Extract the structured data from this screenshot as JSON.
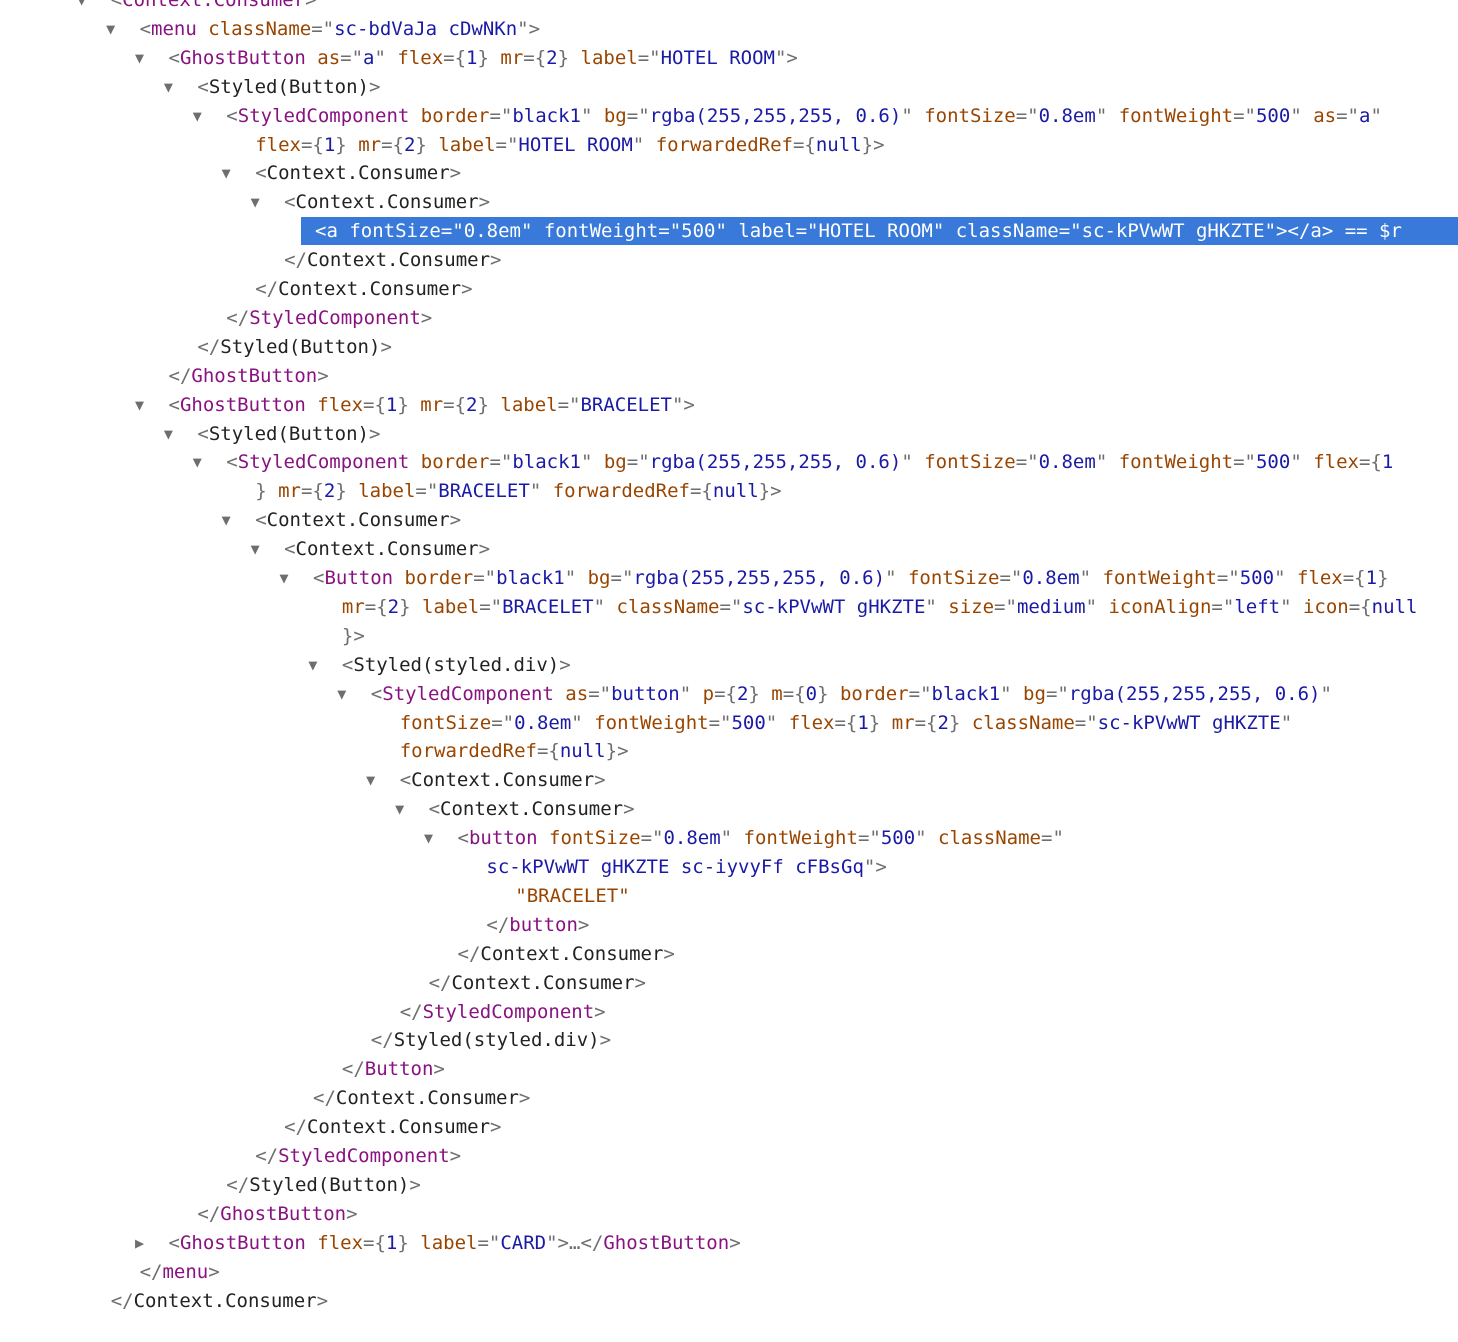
{
  "tree": [
    [
      3,
      "down",
      "<",
      "Context.Consumer",
      ">"
    ],
    [
      4,
      "down",
      "<",
      "menu",
      " ",
      "className",
      "=\"",
      "sc-bdVaJa cDwNKn",
      "\">"
    ],
    [
      5,
      "down",
      "<",
      "GhostButton",
      " ",
      "as",
      "=\"",
      "a",
      "\" ",
      "flex",
      "={",
      "1",
      "} ",
      "mr",
      "={",
      "2",
      "} ",
      "label",
      "=\"",
      "HOTEL ROOM",
      "\">"
    ],
    [
      6,
      "down",
      "<",
      "Styled(Button)",
      ">"
    ],
    [
      7,
      "down",
      "<",
      "StyledComponent",
      " ",
      "border",
      "=\"",
      "black1",
      "\" ",
      "bg",
      "=\"",
      "rgba(255,255,255, 0.6)",
      "\" ",
      "fontSize",
      "=\"",
      "0.8em",
      "\" ",
      "fontWeight",
      "=\"",
      "500",
      "\" ",
      "as",
      "=\"",
      "a",
      "\""
    ],
    [
      8,
      "",
      "flex",
      "={",
      "1",
      "} ",
      "mr",
      "={",
      "2",
      "} ",
      "label",
      "=\"",
      "HOTEL ROOM",
      "\" ",
      "forwardedRef",
      "={",
      "null",
      "}>"
    ],
    [
      8,
      "down",
      "<",
      "Context.Consumer",
      ">"
    ],
    [
      9,
      "down",
      "<",
      "Context.Consumer",
      ">"
    ],
    [
      10,
      "",
      "<",
      "a",
      " ",
      "fontSize",
      "=\"",
      "0.8em",
      "\" ",
      "fontWeight",
      "=\"",
      "500",
      "\" ",
      "label",
      "=\"",
      "HOTEL ROOM",
      "\" ",
      "className",
      "=\"",
      "sc-kPVwWT gHKZTE",
      "\">",
      "</",
      "a",
      ">",
      " == $r"
    ],
    [
      9,
      "",
      "</",
      "Context.Consumer",
      ">"
    ],
    [
      8,
      "",
      "</",
      "Context.Consumer",
      ">"
    ],
    [
      7,
      "",
      "</",
      "StyledComponent",
      ">"
    ],
    [
      6,
      "",
      "</",
      "Styled(Button)",
      ">"
    ],
    [
      5,
      "",
      "</",
      "GhostButton",
      ">"
    ],
    [
      5,
      "down",
      "<",
      "GhostButton",
      " ",
      "flex",
      "={",
      "1",
      "} ",
      "mr",
      "={",
      "2",
      "} ",
      "label",
      "=\"",
      "BRACELET",
      "\">"
    ],
    [
      6,
      "down",
      "<",
      "Styled(Button)",
      ">"
    ],
    [
      7,
      "down",
      "<",
      "StyledComponent",
      " ",
      "border",
      "=\"",
      "black1",
      "\" ",
      "bg",
      "=\"",
      "rgba(255,255,255, 0.6)",
      "\" ",
      "fontSize",
      "=\"",
      "0.8em",
      "\" ",
      "fontWeight",
      "=\"",
      "500",
      "\" ",
      "flex",
      "={",
      "1"
    ],
    [
      8,
      "",
      "} ",
      "mr",
      "={",
      "2",
      "} ",
      "label",
      "=\"",
      "BRACELET",
      "\" ",
      "forwardedRef",
      "={",
      "null",
      "}>"
    ],
    [
      8,
      "down",
      "<",
      "Context.Consumer",
      ">"
    ],
    [
      9,
      "down",
      "<",
      "Context.Consumer",
      ">"
    ],
    [
      10,
      "down",
      "<",
      "Button",
      " ",
      "border",
      "=\"",
      "black1",
      "\" ",
      "bg",
      "=\"",
      "rgba(255,255,255, 0.6)",
      "\" ",
      "fontSize",
      "=\"",
      "0.8em",
      "\" ",
      "fontWeight",
      "=\"",
      "500",
      "\" ",
      "flex",
      "={",
      "1",
      "}"
    ],
    [
      11,
      "",
      "mr",
      "={",
      "2",
      "} ",
      "label",
      "=\"",
      "BRACELET",
      "\" ",
      "className",
      "=\"",
      "sc-kPVwWT gHKZTE",
      "\" ",
      "size",
      "=\"",
      "medium",
      "\" ",
      "iconAlign",
      "=\"",
      "left",
      "\" ",
      "icon",
      "={",
      "null"
    ],
    [
      11,
      "",
      "}>"
    ],
    [
      11,
      "down",
      "<",
      "Styled(styled.div)",
      ">"
    ],
    [
      12,
      "down",
      "<",
      "StyledComponent",
      " ",
      "as",
      "=\"",
      "button",
      "\" ",
      "p",
      "={",
      "2",
      "} ",
      "m",
      "={",
      "0",
      "} ",
      "border",
      "=\"",
      "black1",
      "\" ",
      "bg",
      "=\"",
      "rgba(255,255,255, 0.6)",
      "\""
    ],
    [
      13,
      "",
      "fontSize",
      "=\"",
      "0.8em",
      "\" ",
      "fontWeight",
      "=\"",
      "500",
      "\" ",
      "flex",
      "={",
      "1",
      "} ",
      "mr",
      "={",
      "2",
      "} ",
      "className",
      "=\"",
      "sc-kPVwWT gHKZTE",
      "\""
    ],
    [
      13,
      "",
      "forwardedRef",
      "={",
      "null",
      "}>"
    ],
    [
      13,
      "down",
      "<",
      "Context.Consumer",
      ">"
    ],
    [
      14,
      "down",
      "<",
      "Context.Consumer",
      ">"
    ],
    [
      15,
      "down",
      "<",
      "button",
      " ",
      "fontSize",
      "=\"",
      "0.8em",
      "\" ",
      "fontWeight",
      "=\"",
      "500",
      "\" ",
      "className",
      "=\""
    ],
    [
      16,
      "",
      "sc-kPVwWT gHKZTE sc-iyvyFf cFBsGq",
      "\">"
    ],
    [
      17,
      "",
      "\"BRACELET\""
    ],
    [
      16,
      "",
      "</",
      "button",
      ">"
    ],
    [
      15,
      "",
      "</",
      "Context.Consumer",
      ">"
    ],
    [
      14,
      "",
      "</",
      "Context.Consumer",
      ">"
    ],
    [
      13,
      "",
      "</",
      "StyledComponent",
      ">"
    ],
    [
      12,
      "",
      "</",
      "Styled(styled.div)",
      ">"
    ],
    [
      11,
      "",
      "</",
      "Button",
      ">"
    ],
    [
      10,
      "",
      "</",
      "Context.Consumer",
      ">"
    ],
    [
      9,
      "",
      "</",
      "Context.Consumer",
      ">"
    ],
    [
      8,
      "",
      "</",
      "StyledComponent",
      ">"
    ],
    [
      7,
      "",
      "</",
      "Styled(Button)",
      ">"
    ],
    [
      6,
      "",
      "</",
      "GhostButton",
      ">"
    ],
    [
      5,
      "right",
      "<",
      "GhostButton",
      " ",
      "flex",
      "={",
      "1",
      "} ",
      "label",
      "=\"",
      "CARD",
      "\">",
      "…",
      "</",
      "GhostButton",
      ">"
    ],
    [
      4,
      "",
      "</",
      "menu",
      ">"
    ],
    [
      3,
      "",
      "</",
      "Context.Consumer",
      ">"
    ]
  ],
  "roles": [
    [
      "p",
      "t",
      "p"
    ],
    [
      "p",
      "d",
      "p",
      "a",
      "p",
      "v",
      "p"
    ],
    [
      "p",
      "t",
      "p",
      "a",
      "p",
      "v",
      "p",
      "a",
      "p",
      "v",
      "p",
      "a",
      "p",
      "v",
      "p",
      "a",
      "p",
      "v",
      "p"
    ],
    [
      "p",
      "h",
      "p"
    ],
    [
      "p",
      "t",
      "p",
      "a",
      "p",
      "v",
      "p",
      "a",
      "p",
      "v",
      "p",
      "a",
      "p",
      "v",
      "p",
      "a",
      "p",
      "v",
      "p",
      "a",
      "p",
      "v",
      "p"
    ],
    [
      "a",
      "p",
      "v",
      "p",
      "a",
      "p",
      "v",
      "p",
      "a",
      "p",
      "v",
      "p",
      "a",
      "p",
      "v",
      "p"
    ],
    [
      "p",
      "h",
      "p"
    ],
    [
      "p",
      "h",
      "p"
    ],
    [
      "p",
      "d",
      "p",
      "a",
      "p",
      "v",
      "p",
      "a",
      "p",
      "v",
      "p",
      "a",
      "p",
      "v",
      "p",
      "a",
      "p",
      "v",
      "p",
      "p",
      "d",
      "p",
      "p"
    ],
    [
      "p",
      "h",
      "p"
    ],
    [
      "p",
      "h",
      "p"
    ],
    [
      "p",
      "t",
      "p"
    ],
    [
      "p",
      "h",
      "p"
    ],
    [
      "p",
      "t",
      "p"
    ],
    [
      "p",
      "t",
      "p",
      "a",
      "p",
      "v",
      "p",
      "a",
      "p",
      "v",
      "p",
      "a",
      "p",
      "v",
      "p"
    ],
    [
      "p",
      "h",
      "p"
    ],
    [
      "p",
      "t",
      "p",
      "a",
      "p",
      "v",
      "p",
      "a",
      "p",
      "v",
      "p",
      "a",
      "p",
      "v",
      "p",
      "a",
      "p",
      "v",
      "p",
      "a",
      "p",
      "v"
    ],
    [
      "p",
      "a",
      "p",
      "v",
      "p",
      "a",
      "p",
      "v",
      "p",
      "a",
      "p",
      "v",
      "p"
    ],
    [
      "p",
      "h",
      "p"
    ],
    [
      "p",
      "h",
      "p"
    ],
    [
      "p",
      "t",
      "p",
      "a",
      "p",
      "v",
      "p",
      "a",
      "p",
      "v",
      "p",
      "a",
      "p",
      "v",
      "p",
      "a",
      "p",
      "v",
      "p",
      "a",
      "p",
      "v",
      "p"
    ],
    [
      "a",
      "p",
      "v",
      "p",
      "a",
      "p",
      "v",
      "p",
      "a",
      "p",
      "v",
      "p",
      "a",
      "p",
      "v",
      "p",
      "a",
      "p",
      "v",
      "p",
      "a",
      "p",
      "v"
    ],
    [
      "p"
    ],
    [
      "p",
      "h",
      "p"
    ],
    [
      "p",
      "t",
      "p",
      "a",
      "p",
      "v",
      "p",
      "a",
      "p",
      "v",
      "p",
      "a",
      "p",
      "v",
      "p",
      "a",
      "p",
      "v",
      "p",
      "a",
      "p",
      "v",
      "p"
    ],
    [
      "a",
      "p",
      "v",
      "p",
      "a",
      "p",
      "v",
      "p",
      "a",
      "p",
      "v",
      "p",
      "a",
      "p",
      "v",
      "p",
      "a",
      "p",
      "v",
      "p"
    ],
    [
      "a",
      "p",
      "v",
      "p"
    ],
    [
      "p",
      "h",
      "p"
    ],
    [
      "p",
      "h",
      "p"
    ],
    [
      "p",
      "d",
      "p",
      "a",
      "p",
      "v",
      "p",
      "a",
      "p",
      "v",
      "p",
      "a",
      "p"
    ],
    [
      "v",
      "p"
    ],
    [
      "s"
    ],
    [
      "p",
      "d",
      "p"
    ],
    [
      "p",
      "h",
      "p"
    ],
    [
      "p",
      "h",
      "p"
    ],
    [
      "p",
      "t",
      "p"
    ],
    [
      "p",
      "h",
      "p"
    ],
    [
      "p",
      "t",
      "p"
    ],
    [
      "p",
      "h",
      "p"
    ],
    [
      "p",
      "h",
      "p"
    ],
    [
      "p",
      "t",
      "p"
    ],
    [
      "p",
      "h",
      "p"
    ],
    [
      "p",
      "t",
      "p"
    ],
    [
      "p",
      "t",
      "p",
      "a",
      "p",
      "v",
      "p",
      "a",
      "p",
      "v",
      "p",
      "p",
      "p",
      "t",
      "p"
    ],
    [
      "p",
      "d",
      "p"
    ],
    [
      "p",
      "h",
      "p"
    ]
  ],
  "selected_line": 8,
  "colors": {
    "punctuation": "#6e6e6e",
    "component_tag": "#881280",
    "dom_tag": "#881280",
    "attribute": "#994500",
    "value": "#1a1aa6",
    "text_node": "#994500",
    "selection_bg": "#3879d9"
  },
  "icons": {
    "down": "expand-triangle-down-icon",
    "right": "collapse-triangle-right-icon"
  }
}
